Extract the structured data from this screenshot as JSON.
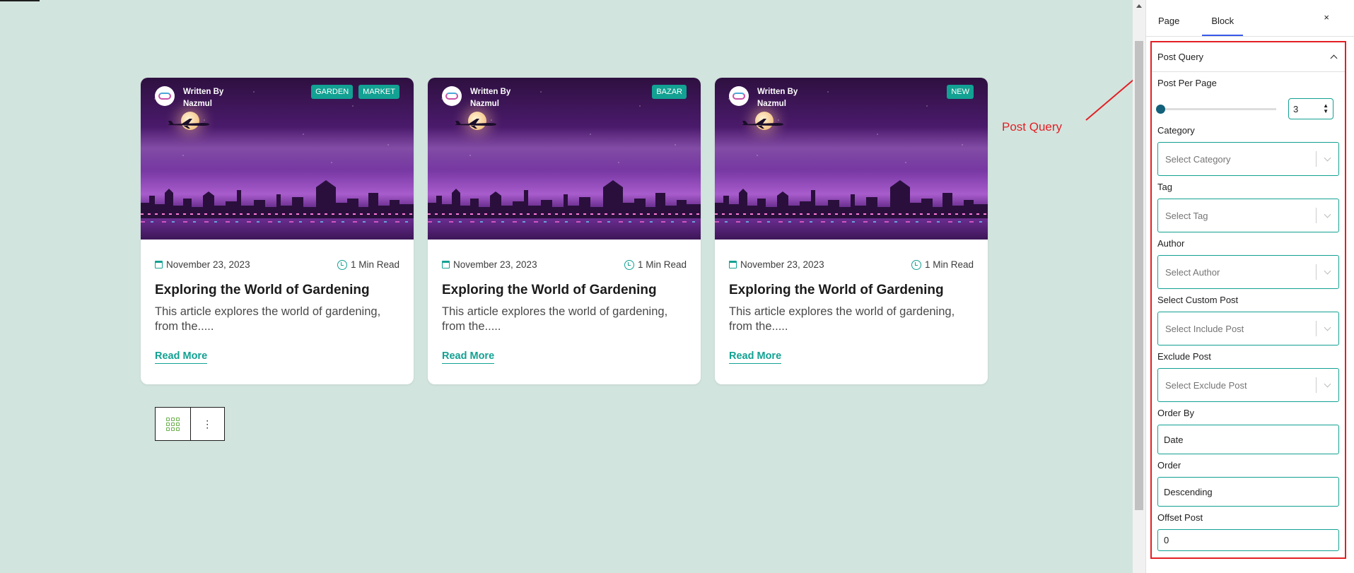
{
  "colors": {
    "accent": "#12a192",
    "annotation": "#e31f25",
    "canvas_bg": "#d2e4de"
  },
  "cards": [
    {
      "author_label": "Written By",
      "author_name": "Nazmul",
      "badges": [
        "GARDEN",
        "MARKET"
      ],
      "date": "November 23, 2023",
      "read_time": "1 Min Read",
      "title": "Exploring the World of Gardening",
      "excerpt": "This article explores the world of gardening, from the.....",
      "read_more": "Read More"
    },
    {
      "author_label": "Written By",
      "author_name": "Nazmul",
      "badges": [
        "BAZAR"
      ],
      "date": "November 23, 2023",
      "read_time": "1 Min Read",
      "title": "Exploring the World of Gardening",
      "excerpt": "This article explores the world of gardening, from the.....",
      "read_more": "Read More"
    },
    {
      "author_label": "Written By",
      "author_name": "Nazmul",
      "badges": [
        "NEW"
      ],
      "date": "November 23, 2023",
      "read_time": "1 Min Read",
      "title": "Exploring the World of Gardening",
      "excerpt": "This article explores the world of gardening, from the.....",
      "read_more": "Read More"
    }
  ],
  "block_toolbar": {
    "icons": [
      "grid-icon",
      "more-options-icon"
    ],
    "more_glyph": "⋮"
  },
  "annotation": {
    "text": "Post Query"
  },
  "sidebar": {
    "tabs": [
      "Page",
      "Block"
    ],
    "active_tab": "Block",
    "close_glyph": "×",
    "panel_title": "Post Query",
    "post_per_page": {
      "label": "Post Per Page",
      "value": "3",
      "slider_level": 0.02
    },
    "category": {
      "label": "Category",
      "placeholder": "Select Category"
    },
    "tag": {
      "label": "Tag",
      "placeholder": "Select Tag"
    },
    "author": {
      "label": "Author",
      "placeholder": "Select Author"
    },
    "custom_post": {
      "label": "Select Custom Post",
      "placeholder": "Select Include Post"
    },
    "exclude_post": {
      "label": "Exclude Post",
      "placeholder": "Select Exclude Post"
    },
    "order_by": {
      "label": "Order By",
      "value": "Date"
    },
    "order": {
      "label": "Order",
      "value": "Descending"
    },
    "offset": {
      "label": "Offset Post",
      "value": "0"
    }
  }
}
